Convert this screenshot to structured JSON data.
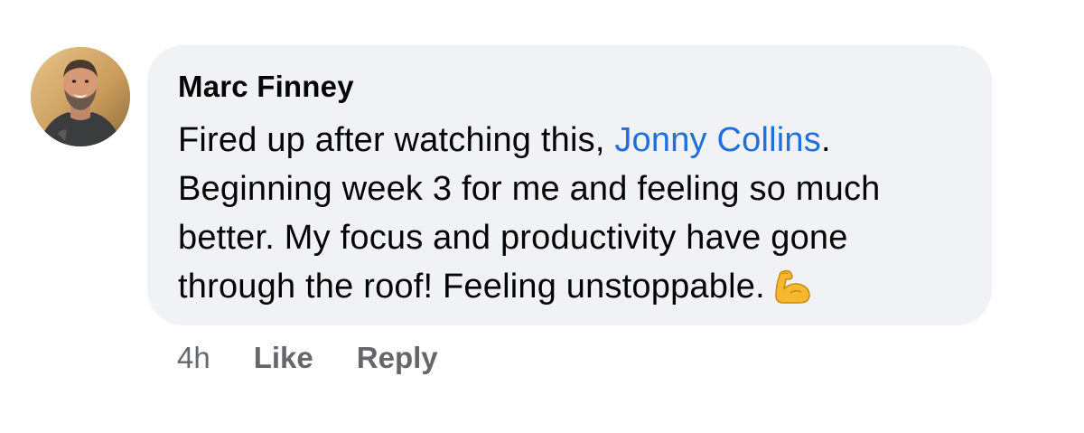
{
  "comment": {
    "author": "Marc Finney",
    "text_before_mention": "Fired up after watching this, ",
    "mention": "Jonny Collins",
    "text_after_mention": ". Beginning week 3 for me and feeling so much better. My focus and productivity have gone through the roof! Feeling unstoppable.",
    "emoji_icon": "flexed-biceps-icon",
    "avatar_icon": "profile-photo"
  },
  "actions": {
    "time": "4h",
    "like_label": "Like",
    "reply_label": "Reply"
  },
  "colors": {
    "bubble_bg": "#f0f2f5",
    "mention": "#216fdb",
    "meta_text": "#65676b",
    "primary_text": "#050505"
  }
}
